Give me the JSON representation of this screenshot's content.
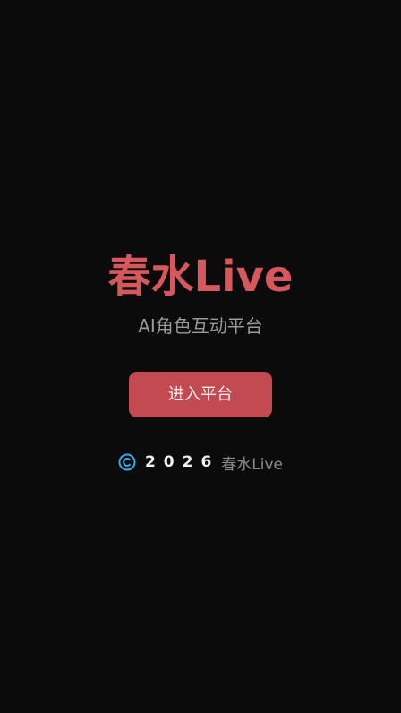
{
  "app": {
    "title": "春水Live",
    "subtitle": "AI角色互动平台"
  },
  "actions": {
    "enter_label": "进入平台"
  },
  "footer": {
    "year": "2026",
    "brand": "春水Live"
  },
  "colors": {
    "background": "#0b0b0b",
    "accent": "#d6585d",
    "button": "#c44a51",
    "icon": "#3aa7e8"
  },
  "icons": {
    "copyright": "copyright-icon"
  }
}
